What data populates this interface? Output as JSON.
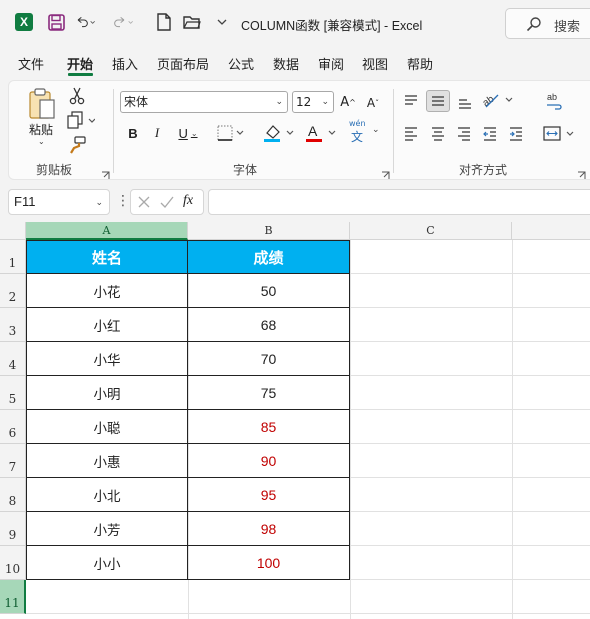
{
  "app": {
    "title": "COLUMN函数  [兼容模式]  -  Excel",
    "logo_letter": "X",
    "search_placeholder": "搜索"
  },
  "tabs": [
    "文件",
    "开始",
    "插入",
    "页面布局",
    "公式",
    "数据",
    "审阅",
    "视图",
    "帮助"
  ],
  "ribbon": {
    "clipboard": {
      "label": "剪贴板",
      "paste_label": "粘贴"
    },
    "font": {
      "label": "字体",
      "font_name": "宋体",
      "font_size": "12",
      "wen_label": "wén",
      "wen_char": "文"
    },
    "alignment": {
      "label": "对齐方式"
    }
  },
  "formula_bar": {
    "name_box": "F11",
    "fx": "fx",
    "formula": ""
  },
  "sheet": {
    "columns": [
      "A",
      "B",
      "C"
    ],
    "rows": [
      "1",
      "2",
      "3",
      "4",
      "5",
      "6",
      "7",
      "8",
      "9",
      "10",
      "11"
    ],
    "header": [
      "姓名",
      "成绩"
    ],
    "data": [
      {
        "name": "小花",
        "score": "50",
        "red": false
      },
      {
        "name": "小红",
        "score": "68",
        "red": false
      },
      {
        "name": "小华",
        "score": "70",
        "red": false
      },
      {
        "name": "小明",
        "score": "75",
        "red": false
      },
      {
        "name": "小聪",
        "score": "85",
        "red": true
      },
      {
        "name": "小惠",
        "score": "90",
        "red": true
      },
      {
        "name": "小北",
        "score": "95",
        "red": true
      },
      {
        "name": "小芳",
        "score": "98",
        "red": true
      },
      {
        "name": "小小",
        "score": "100",
        "red": true
      }
    ],
    "colors": {
      "header_fill": "#00b0f0",
      "header_text": "#ffffff",
      "red_text": "#c00000",
      "accent": "#107c41"
    }
  }
}
